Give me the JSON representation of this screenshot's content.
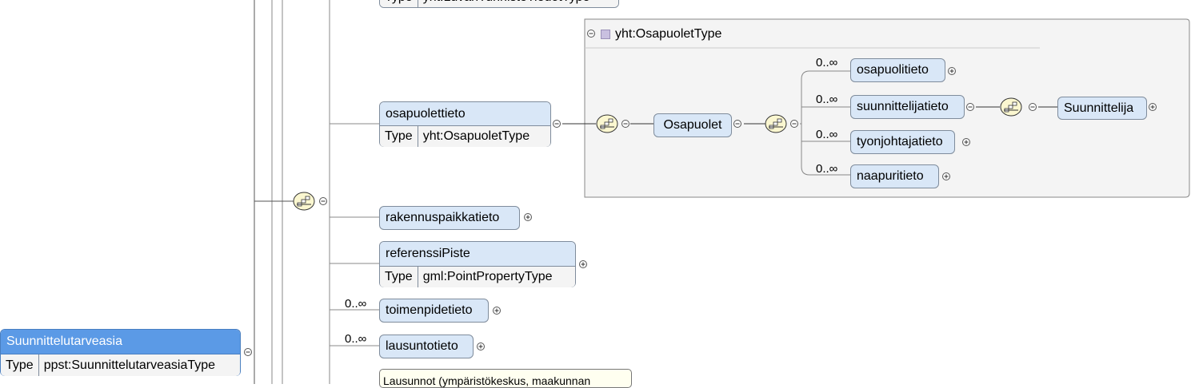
{
  "root": {
    "name": "Suunnittelutarveasia",
    "type_label": "Type",
    "type_value": "ppst:SuunnittelutarveasiaType"
  },
  "top_element": {
    "type_label": "Type",
    "type_value": "yht:LuvanTunnisteTiedotType"
  },
  "osapuolettieto": {
    "name": "osapuolettieto",
    "type_label": "Type",
    "type_value": "yht:OsapuoletType"
  },
  "complex_type": {
    "name": "yht:OsapuoletType"
  },
  "osapuolet": {
    "name": "Osapuolet"
  },
  "children": [
    {
      "name": "osapuolitieto",
      "cardinality": "0..∞"
    },
    {
      "name": "suunnittelijatieto",
      "cardinality": "0..∞"
    },
    {
      "name": "tyonjohtajatieto",
      "cardinality": "0..∞"
    },
    {
      "name": "naapuritieto",
      "cardinality": "0..∞"
    }
  ],
  "suunnittelija": {
    "name": "Suunnittelija"
  },
  "rakennuspaikkatieto": {
    "name": "rakennuspaikkatieto"
  },
  "referenssiPiste": {
    "name": "referenssiPiste",
    "type_label": "Type",
    "type_value": "gml:PointPropertyType"
  },
  "toimenpidetieto": {
    "name": "toimenpidetieto",
    "cardinality": "0..∞"
  },
  "lausuntotieto": {
    "name": "lausuntotieto",
    "cardinality": "0..∞"
  },
  "tooltip": {
    "text": "Lausunnot (ympäristökeskus, maakunnan"
  },
  "icons": {
    "sequence": "sequence-compositor-icon",
    "collapse": "collapse-icon",
    "expand": "expand-icon",
    "type_marker": "complex-type-icon"
  },
  "colors": {
    "element_fill": "#d9e7f7",
    "root_fill": "#5b9ae6",
    "border": "#7f8c9c",
    "line": "#888888"
  }
}
